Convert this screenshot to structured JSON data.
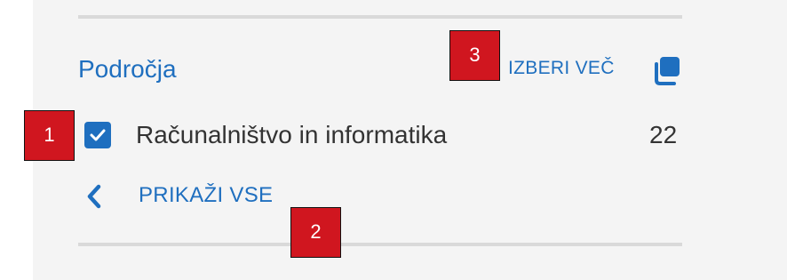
{
  "filter": {
    "title": "Področja",
    "select_more_label": "IZBERI VEČ",
    "options": [
      {
        "label": "Računalništvo in informatika",
        "count": "22",
        "checked": true
      }
    ],
    "show_all_label": "PRIKAŽI VSE"
  },
  "markers": [
    "1",
    "2",
    "3"
  ],
  "colors": {
    "accent": "#1f6fbf",
    "panel_bg": "#f4f4f4",
    "divider": "#d9d9d9",
    "marker": "#d0161f",
    "text": "#333333"
  },
  "icons": {
    "select_more": "copy-icon",
    "checkbox": "check-icon",
    "show_all": "chevron-left-icon"
  }
}
